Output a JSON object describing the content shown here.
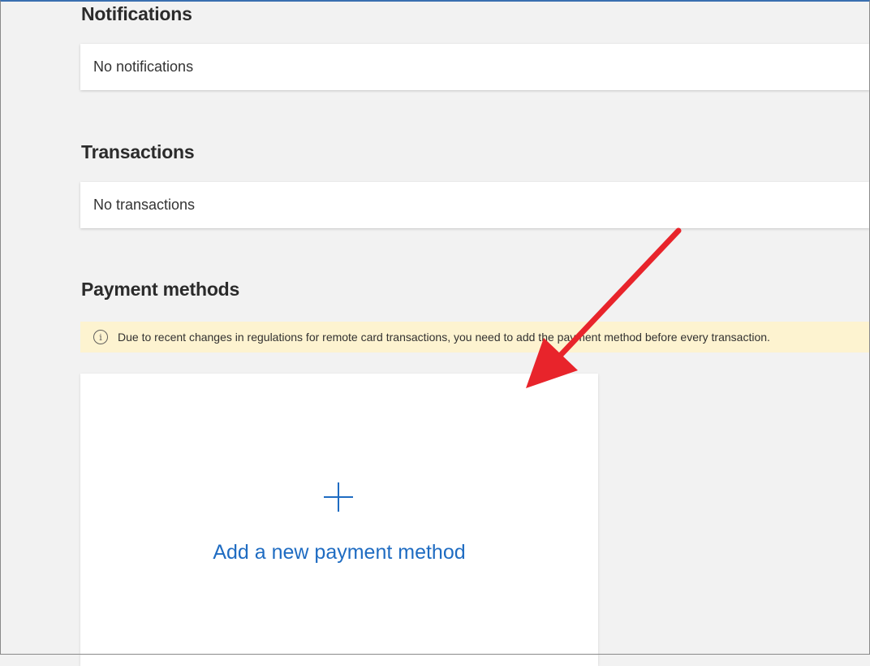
{
  "sections": {
    "notifications": {
      "heading": "Notifications",
      "empty_text": "No notifications"
    },
    "transactions": {
      "heading": "Transactions",
      "empty_text": "No transactions"
    },
    "payment_methods": {
      "heading": "Payment methods",
      "notice": "Due to recent changes in regulations for remote card transactions, you need to add the payment method before every transaction.",
      "notice_icon": "info-icon",
      "add_label": "Add a new payment method",
      "add_icon": "plus-icon"
    }
  },
  "colors": {
    "accent": "#1f6cc2",
    "notice_background": "#fdf3d0",
    "annotation_arrow": "#e8242b"
  }
}
